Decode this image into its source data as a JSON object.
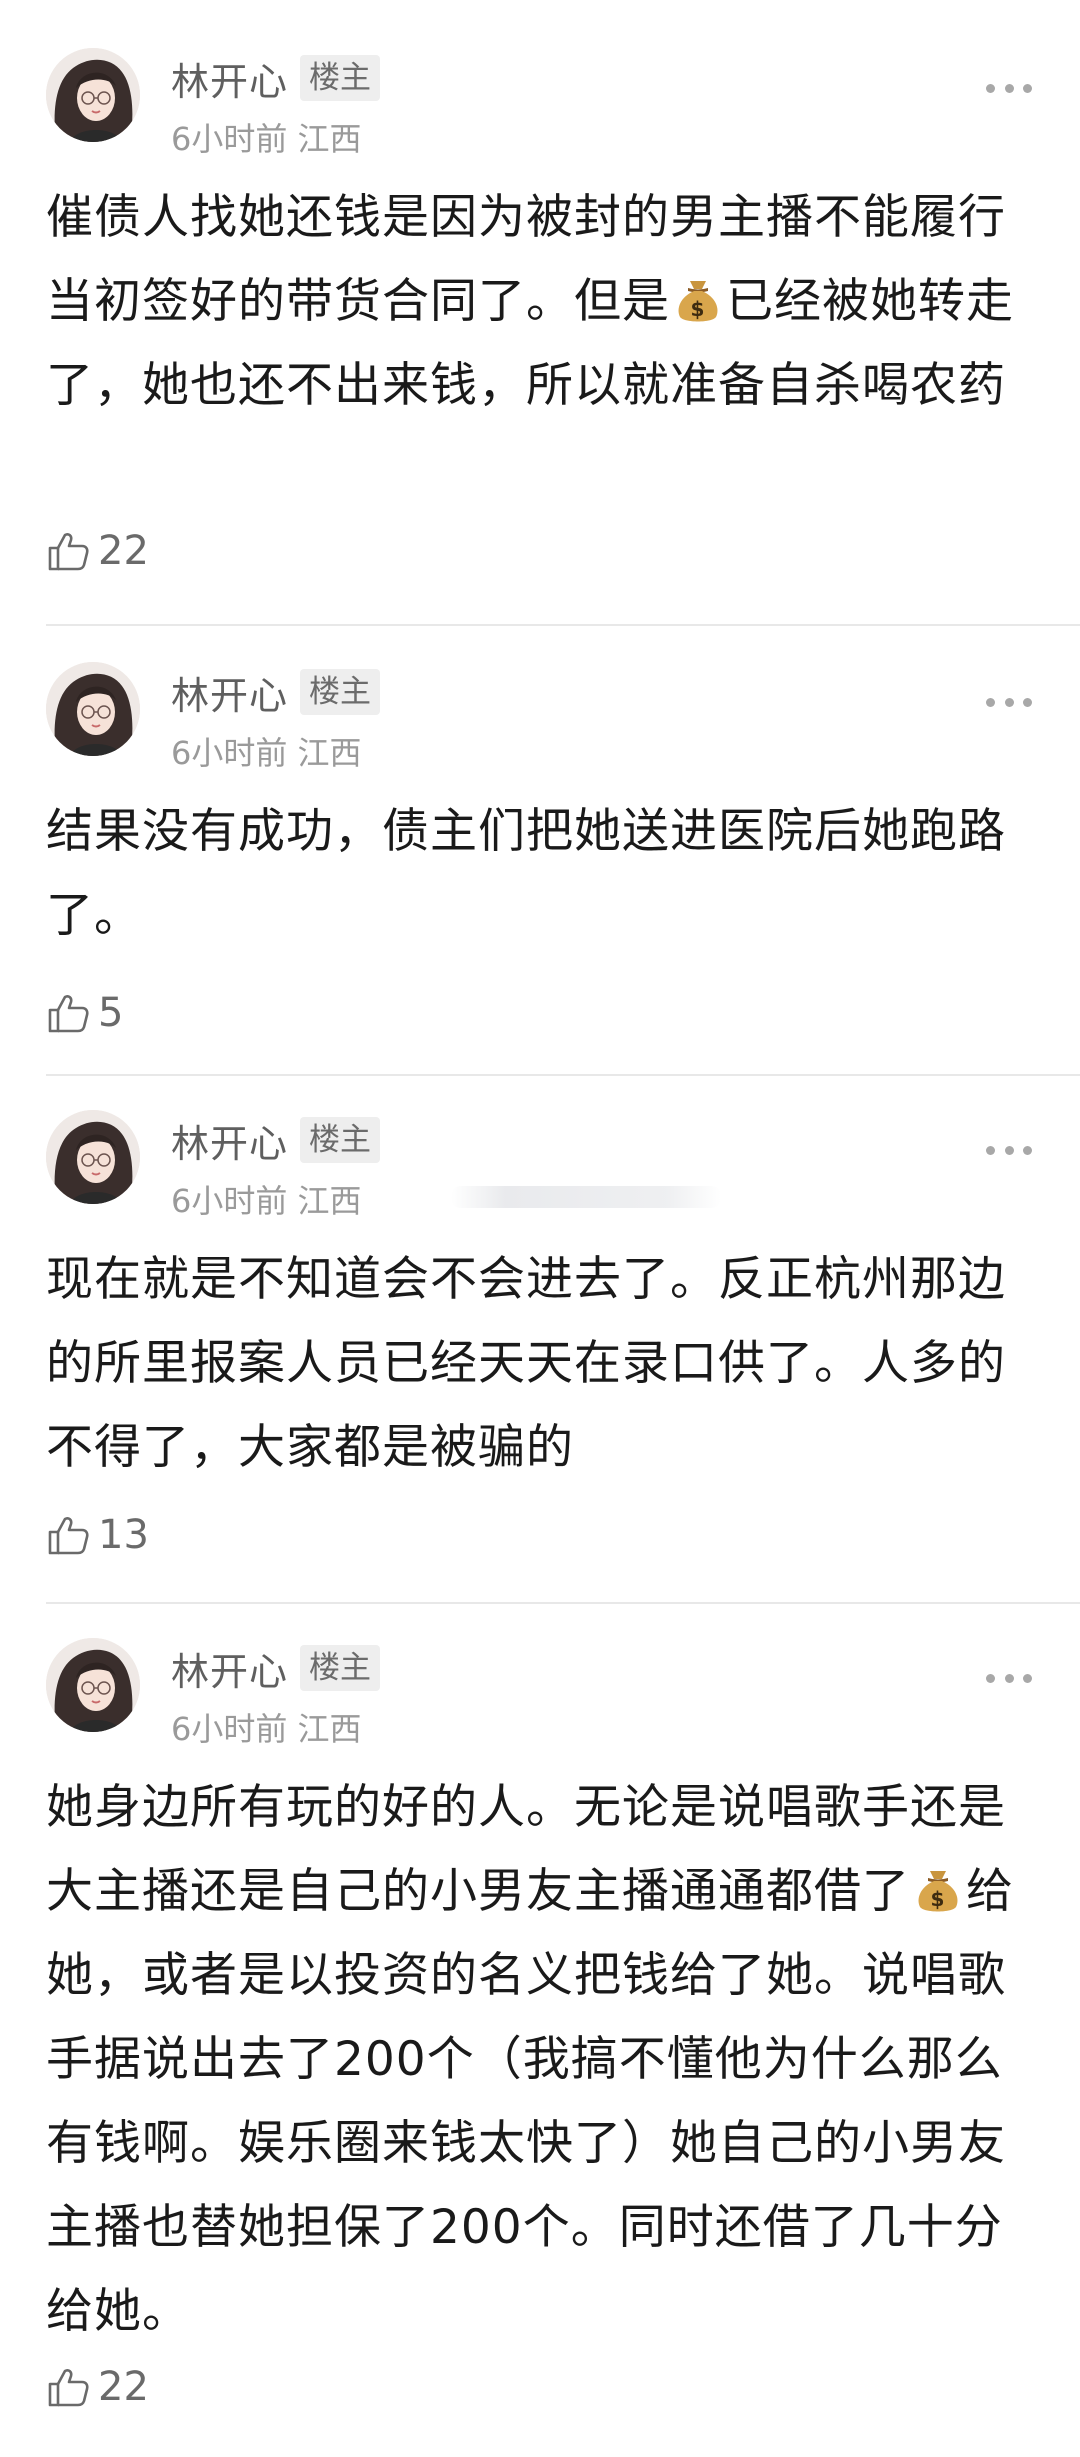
{
  "comments": [
    {
      "author": "林开心",
      "badge": "楼主",
      "time": "6小时前",
      "location": "江西",
      "text_parts": [
        "催债人找她还钱是因为被封的男主播不能履行当初签好的带货合同了。但是",
        "已经被她转走了，她也还不出来钱，所以就准备自杀喝农药"
      ],
      "likes": "22"
    },
    {
      "author": "林开心",
      "badge": "楼主",
      "time": "6小时前",
      "location": "江西",
      "text": "结果没有成功，债主们把她送进医院后她跑路了。",
      "likes": "5"
    },
    {
      "author": "林开心",
      "badge": "楼主",
      "time": "6小时前",
      "location": "江西",
      "text": "现在就是不知道会不会进去了。反正杭州那边的所里报案人员已经天天在录口供了。人多的不得了，大家都是被骗的",
      "likes": "13"
    },
    {
      "author": "林开心",
      "badge": "楼主",
      "time": "6小时前",
      "location": "江西",
      "text_parts": [
        "她身边所有玩的好的人。无论是说唱歌手还是大主播还是自己的小男友主播通通都借了",
        "给她，或者是以投资的名义把钱给了她。说唱歌手据说出去了200个（我搞不懂他为什么那么有钱啊。娱乐圈来钱太快了）她自己的小男友主播也替她担保了200个。同时还借了几十分给她。"
      ],
      "likes": "22"
    }
  ],
  "icons": {
    "money": "money-bag-icon",
    "like": "thumbs-up-icon",
    "more": "more-dots-icon"
  },
  "colors": {
    "text": "#1a1a1a",
    "author": "#5f5f5f",
    "meta": "#9a9a9a",
    "badge_bg": "#eeeeee",
    "divider": "#e8e8e8"
  }
}
